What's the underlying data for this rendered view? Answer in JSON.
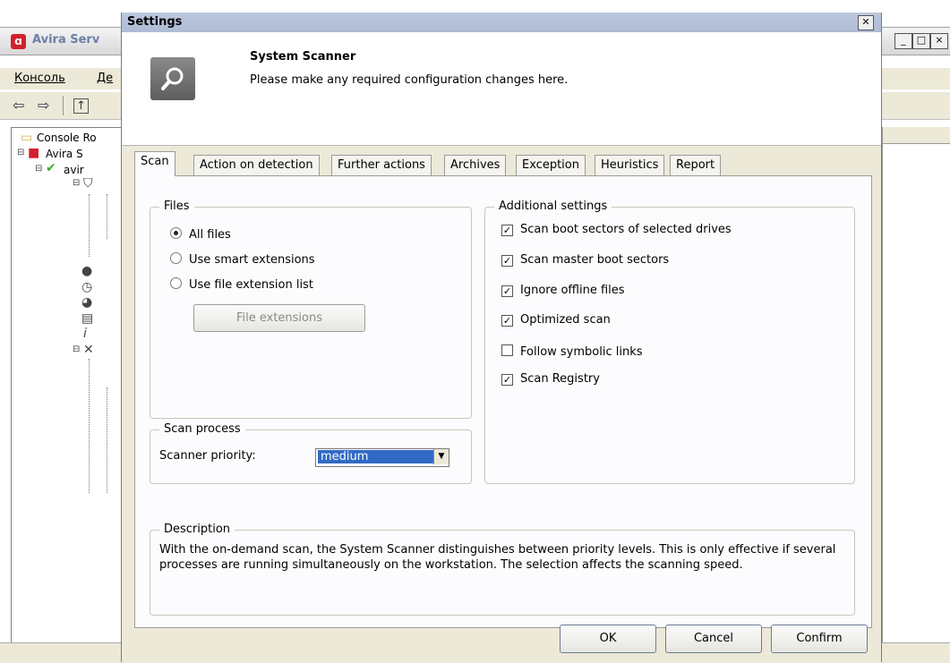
{
  "background_window": {
    "title": "Avira Serv",
    "menu": [
      "Консоль",
      "Де"
    ],
    "tree": {
      "root": "Console Ro",
      "child": "Avira S",
      "grandchild": "avir"
    }
  },
  "dialog": {
    "title": "Settings",
    "close_glyph": "✕",
    "header": {
      "title": "System Scanner",
      "subtitle": "Please make any required configuration changes here.",
      "icon": "search-icon"
    },
    "tabs": [
      {
        "label": "Scan",
        "active": true
      },
      {
        "label": "Action on detection",
        "active": false
      },
      {
        "label": "Further actions",
        "active": false
      },
      {
        "label": "Archives",
        "active": false
      },
      {
        "label": "Exception",
        "active": false
      },
      {
        "label": "Heuristics",
        "active": false
      },
      {
        "label": "Report",
        "active": false
      }
    ],
    "files": {
      "legend": "Files",
      "options": [
        {
          "label": "All files",
          "selected": true
        },
        {
          "label": "Use smart extensions",
          "selected": false
        },
        {
          "label": "Use file extension list",
          "selected": false
        }
      ],
      "button": "File extensions",
      "button_enabled": false
    },
    "scan_process": {
      "legend": "Scan process",
      "priority_label": "Scanner priority:",
      "priority_value": "medium"
    },
    "additional_settings": {
      "legend": "Additional settings",
      "items": [
        {
          "label": "Scan boot sectors of selected drives",
          "checked": true
        },
        {
          "label": "Scan master boot sectors",
          "checked": true
        },
        {
          "label": "Ignore offline files",
          "checked": true
        },
        {
          "label": "Optimized scan",
          "checked": true
        },
        {
          "label": "Follow symbolic links",
          "checked": false
        },
        {
          "label": "Scan Registry",
          "checked": true
        }
      ]
    },
    "description": {
      "legend": "Description",
      "text": "With the on-demand scan, the System Scanner distinguishes between priority levels. This is only effective if several processes are running simultaneously on the workstation. The selection affects the scanning speed."
    },
    "buttons": {
      "ok": "OK",
      "cancel": "Cancel",
      "confirm": "Confirm"
    }
  },
  "colors": {
    "selection": "#316ac5",
    "dialog_bg": "#ece9d8",
    "panel_bg": "#fcfcfe"
  }
}
